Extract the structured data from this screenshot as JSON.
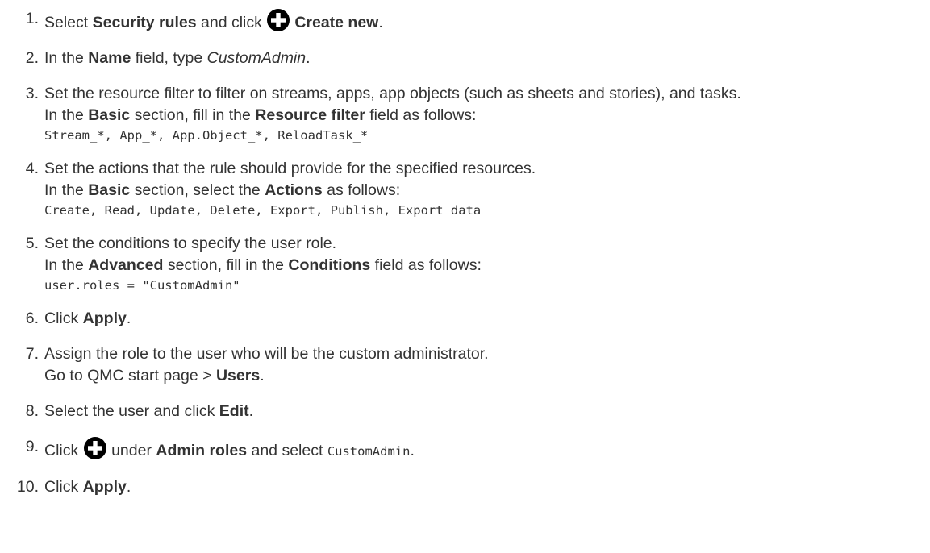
{
  "steps": [
    {
      "num": "1.",
      "t1": "Select ",
      "b1": "Security rules",
      "t2": " and click ",
      "icon": "plus-circle-icon",
      "b2": "Create new",
      "t3": "."
    },
    {
      "num": "2.",
      "t1": "In the ",
      "b1": "Name",
      "t2": " field, type ",
      "i1": "CustomAdmin",
      "t3": "."
    },
    {
      "num": "3.",
      "line1": "Set the resource filter to filter on streams, apps, app objects (such as sheets and stories), and tasks.",
      "t1": "In the ",
      "b1": "Basic",
      "t2": " section, fill in the ",
      "b2": "Resource filter",
      "t3": " field as follows:",
      "code": "Stream_*, App_*, App.Object_*, ReloadTask_*"
    },
    {
      "num": "4.",
      "line1": "Set the actions that the rule should provide for the specified resources.",
      "t1": "In the ",
      "b1": "Basic",
      "t2": " section, select the ",
      "b2": "Actions",
      "t3": " as follows:",
      "code": "Create, Read, Update, Delete, Export, Publish, Export data"
    },
    {
      "num": "5.",
      "line1": "Set the conditions to specify the user role.",
      "t1": "In the ",
      "b1": "Advanced",
      "t2": " section, fill in the ",
      "b2": "Conditions",
      "t3": " field as follows:",
      "code": "user.roles = \"CustomAdmin\""
    },
    {
      "num": "6.",
      "t1": "Click ",
      "b1": "Apply",
      "t2": "."
    },
    {
      "num": "7.",
      "line1": "Assign the role to the user who will be the custom administrator.",
      "t1": "Go to QMC start page > ",
      "b1": "Users",
      "t2": "."
    },
    {
      "num": "8.",
      "t1": "Select the user and click ",
      "b1": "Edit",
      "t2": "."
    },
    {
      "num": "9.",
      "t1": "Click ",
      "icon": "plus-circle-icon",
      "t2": " under ",
      "b1": "Admin roles",
      "t3": " and select ",
      "code": "CustomAdmin",
      "t4": "."
    },
    {
      "num": "10.",
      "t1": "Click ",
      "b1": "Apply",
      "t2": "."
    }
  ]
}
